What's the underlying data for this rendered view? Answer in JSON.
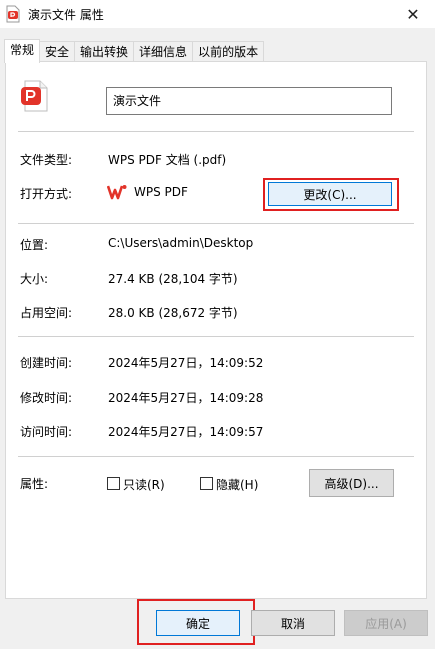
{
  "window": {
    "title": "演示文件 属性",
    "close_glyph": "✕"
  },
  "tabs": [
    {
      "label": "常规"
    },
    {
      "label": "安全"
    },
    {
      "label": "输出转换"
    },
    {
      "label": "详细信息"
    },
    {
      "label": "以前的版本"
    }
  ],
  "general": {
    "filename": "演示文件",
    "file_type_label": "文件类型:",
    "file_type_value": "WPS PDF 文档 (.pdf)",
    "open_with_label": "打开方式:",
    "open_with_value": "WPS PDF",
    "change_button": "更改(C)...",
    "location_label": "位置:",
    "location_value": "C:\\Users\\admin\\Desktop",
    "size_label": "大小:",
    "size_value": "27.4 KB (28,104 字节)",
    "size_on_disk_label": "占用空间:",
    "size_on_disk_value": "28.0 KB (28,672 字节)",
    "created_label": "创建时间:",
    "created_value": "2024年5月27日，14:09:52",
    "modified_label": "修改时间:",
    "modified_value": "2024年5月27日，14:09:28",
    "accessed_label": "访问时间:",
    "accessed_value": "2024年5月27日，14:09:57",
    "attributes_label": "属性:",
    "readonly_label": "只读(R)",
    "hidden_label": "隐藏(H)",
    "advanced_button": "高级(D)..."
  },
  "footer": {
    "ok": "确定",
    "cancel": "取消",
    "apply": "应用(A)"
  },
  "colors": {
    "accent": "#0078d7",
    "highlight": "#e02020",
    "pdf_red": "#e2342a"
  }
}
